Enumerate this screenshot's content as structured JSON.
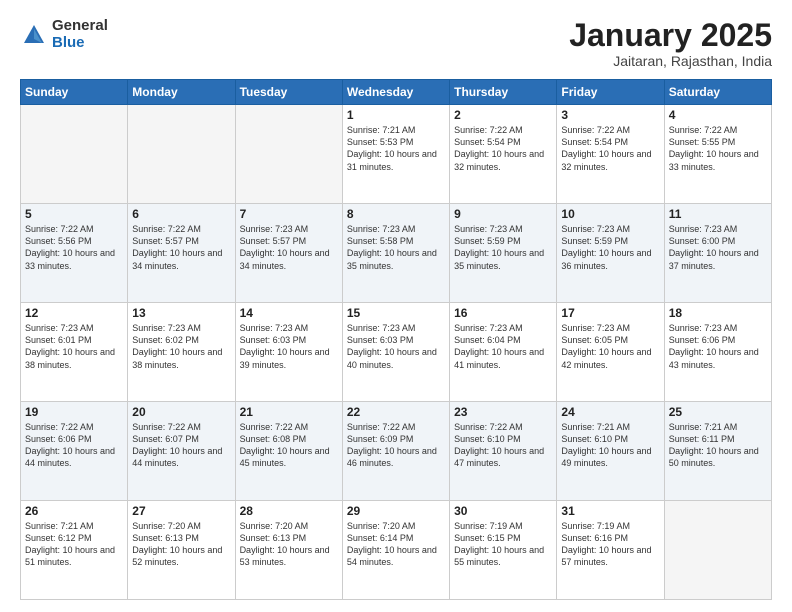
{
  "header": {
    "logo_general": "General",
    "logo_blue": "Blue",
    "month_title": "January 2025",
    "location": "Jaitaran, Rajasthan, India"
  },
  "days_of_week": [
    "Sunday",
    "Monday",
    "Tuesday",
    "Wednesday",
    "Thursday",
    "Friday",
    "Saturday"
  ],
  "weeks": [
    [
      {
        "day": "",
        "sunrise": "",
        "sunset": "",
        "daylight": ""
      },
      {
        "day": "",
        "sunrise": "",
        "sunset": "",
        "daylight": ""
      },
      {
        "day": "",
        "sunrise": "",
        "sunset": "",
        "daylight": ""
      },
      {
        "day": "1",
        "sunrise": "Sunrise: 7:21 AM",
        "sunset": "Sunset: 5:53 PM",
        "daylight": "Daylight: 10 hours and 31 minutes."
      },
      {
        "day": "2",
        "sunrise": "Sunrise: 7:22 AM",
        "sunset": "Sunset: 5:54 PM",
        "daylight": "Daylight: 10 hours and 32 minutes."
      },
      {
        "day": "3",
        "sunrise": "Sunrise: 7:22 AM",
        "sunset": "Sunset: 5:54 PM",
        "daylight": "Daylight: 10 hours and 32 minutes."
      },
      {
        "day": "4",
        "sunrise": "Sunrise: 7:22 AM",
        "sunset": "Sunset: 5:55 PM",
        "daylight": "Daylight: 10 hours and 33 minutes."
      }
    ],
    [
      {
        "day": "5",
        "sunrise": "Sunrise: 7:22 AM",
        "sunset": "Sunset: 5:56 PM",
        "daylight": "Daylight: 10 hours and 33 minutes."
      },
      {
        "day": "6",
        "sunrise": "Sunrise: 7:22 AM",
        "sunset": "Sunset: 5:57 PM",
        "daylight": "Daylight: 10 hours and 34 minutes."
      },
      {
        "day": "7",
        "sunrise": "Sunrise: 7:23 AM",
        "sunset": "Sunset: 5:57 PM",
        "daylight": "Daylight: 10 hours and 34 minutes."
      },
      {
        "day": "8",
        "sunrise": "Sunrise: 7:23 AM",
        "sunset": "Sunset: 5:58 PM",
        "daylight": "Daylight: 10 hours and 35 minutes."
      },
      {
        "day": "9",
        "sunrise": "Sunrise: 7:23 AM",
        "sunset": "Sunset: 5:59 PM",
        "daylight": "Daylight: 10 hours and 35 minutes."
      },
      {
        "day": "10",
        "sunrise": "Sunrise: 7:23 AM",
        "sunset": "Sunset: 5:59 PM",
        "daylight": "Daylight: 10 hours and 36 minutes."
      },
      {
        "day": "11",
        "sunrise": "Sunrise: 7:23 AM",
        "sunset": "Sunset: 6:00 PM",
        "daylight": "Daylight: 10 hours and 37 minutes."
      }
    ],
    [
      {
        "day": "12",
        "sunrise": "Sunrise: 7:23 AM",
        "sunset": "Sunset: 6:01 PM",
        "daylight": "Daylight: 10 hours and 38 minutes."
      },
      {
        "day": "13",
        "sunrise": "Sunrise: 7:23 AM",
        "sunset": "Sunset: 6:02 PM",
        "daylight": "Daylight: 10 hours and 38 minutes."
      },
      {
        "day": "14",
        "sunrise": "Sunrise: 7:23 AM",
        "sunset": "Sunset: 6:03 PM",
        "daylight": "Daylight: 10 hours and 39 minutes."
      },
      {
        "day": "15",
        "sunrise": "Sunrise: 7:23 AM",
        "sunset": "Sunset: 6:03 PM",
        "daylight": "Daylight: 10 hours and 40 minutes."
      },
      {
        "day": "16",
        "sunrise": "Sunrise: 7:23 AM",
        "sunset": "Sunset: 6:04 PM",
        "daylight": "Daylight: 10 hours and 41 minutes."
      },
      {
        "day": "17",
        "sunrise": "Sunrise: 7:23 AM",
        "sunset": "Sunset: 6:05 PM",
        "daylight": "Daylight: 10 hours and 42 minutes."
      },
      {
        "day": "18",
        "sunrise": "Sunrise: 7:23 AM",
        "sunset": "Sunset: 6:06 PM",
        "daylight": "Daylight: 10 hours and 43 minutes."
      }
    ],
    [
      {
        "day": "19",
        "sunrise": "Sunrise: 7:22 AM",
        "sunset": "Sunset: 6:06 PM",
        "daylight": "Daylight: 10 hours and 44 minutes."
      },
      {
        "day": "20",
        "sunrise": "Sunrise: 7:22 AM",
        "sunset": "Sunset: 6:07 PM",
        "daylight": "Daylight: 10 hours and 44 minutes."
      },
      {
        "day": "21",
        "sunrise": "Sunrise: 7:22 AM",
        "sunset": "Sunset: 6:08 PM",
        "daylight": "Daylight: 10 hours and 45 minutes."
      },
      {
        "day": "22",
        "sunrise": "Sunrise: 7:22 AM",
        "sunset": "Sunset: 6:09 PM",
        "daylight": "Daylight: 10 hours and 46 minutes."
      },
      {
        "day": "23",
        "sunrise": "Sunrise: 7:22 AM",
        "sunset": "Sunset: 6:10 PM",
        "daylight": "Daylight: 10 hours and 47 minutes."
      },
      {
        "day": "24",
        "sunrise": "Sunrise: 7:21 AM",
        "sunset": "Sunset: 6:10 PM",
        "daylight": "Daylight: 10 hours and 49 minutes."
      },
      {
        "day": "25",
        "sunrise": "Sunrise: 7:21 AM",
        "sunset": "Sunset: 6:11 PM",
        "daylight": "Daylight: 10 hours and 50 minutes."
      }
    ],
    [
      {
        "day": "26",
        "sunrise": "Sunrise: 7:21 AM",
        "sunset": "Sunset: 6:12 PM",
        "daylight": "Daylight: 10 hours and 51 minutes."
      },
      {
        "day": "27",
        "sunrise": "Sunrise: 7:20 AM",
        "sunset": "Sunset: 6:13 PM",
        "daylight": "Daylight: 10 hours and 52 minutes."
      },
      {
        "day": "28",
        "sunrise": "Sunrise: 7:20 AM",
        "sunset": "Sunset: 6:13 PM",
        "daylight": "Daylight: 10 hours and 53 minutes."
      },
      {
        "day": "29",
        "sunrise": "Sunrise: 7:20 AM",
        "sunset": "Sunset: 6:14 PM",
        "daylight": "Daylight: 10 hours and 54 minutes."
      },
      {
        "day": "30",
        "sunrise": "Sunrise: 7:19 AM",
        "sunset": "Sunset: 6:15 PM",
        "daylight": "Daylight: 10 hours and 55 minutes."
      },
      {
        "day": "31",
        "sunrise": "Sunrise: 7:19 AM",
        "sunset": "Sunset: 6:16 PM",
        "daylight": "Daylight: 10 hours and 57 minutes."
      },
      {
        "day": "",
        "sunrise": "",
        "sunset": "",
        "daylight": ""
      }
    ]
  ]
}
